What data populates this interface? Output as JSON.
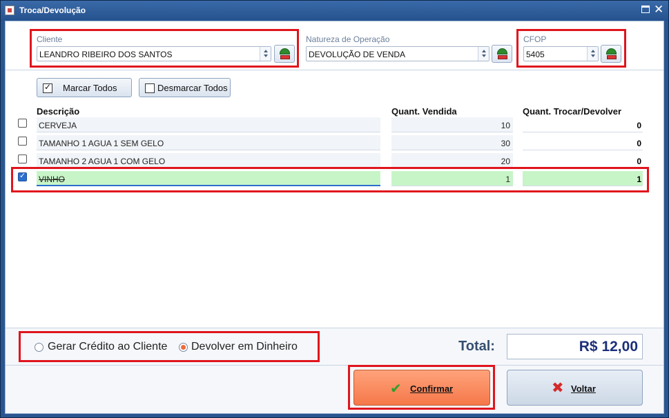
{
  "window": {
    "title": "Troca/Devolução"
  },
  "header": {
    "cliente": {
      "label": "Cliente",
      "value": "LEANDRO RIBEIRO DOS SANTOS"
    },
    "natureza": {
      "label": "Natureza de Operação",
      "value": "DEVOLUÇÃO DE VENDA"
    },
    "cfop": {
      "label": "CFOP",
      "value": "5405"
    }
  },
  "toolbar": {
    "mark_all": "Marcar Todos",
    "unmark_all": "Desmarcar Todos"
  },
  "grid": {
    "columns": {
      "description": "Descrição",
      "sold": "Quant. Vendida",
      "return": "Quant. Trocar/Devolver"
    },
    "rows": [
      {
        "checked": false,
        "description": "CERVEJA",
        "sold": "10",
        "return": "0"
      },
      {
        "checked": false,
        "description": "TAMANHO 1 AGUA 1 SEM GELO",
        "sold": "30",
        "return": "0"
      },
      {
        "checked": false,
        "description": "TAMANHO 2 AGUA 1 COM GELO",
        "sold": "20",
        "return": "0"
      },
      {
        "checked": true,
        "description": "VINHO",
        "sold": "1",
        "return": "1"
      }
    ]
  },
  "options": {
    "credit": {
      "label": "Gerar Crédito ao Cliente",
      "selected": false
    },
    "cash": {
      "label": "Devolver em Dinheiro",
      "selected": true
    }
  },
  "total": {
    "label": "Total:",
    "value": "R$ 12,00"
  },
  "actions": {
    "confirm": "Confirmar",
    "back": "Voltar"
  },
  "colors": {
    "highlight": "#e0141c",
    "selected_row": "#c8f5c8",
    "accent": "#f5784a"
  }
}
